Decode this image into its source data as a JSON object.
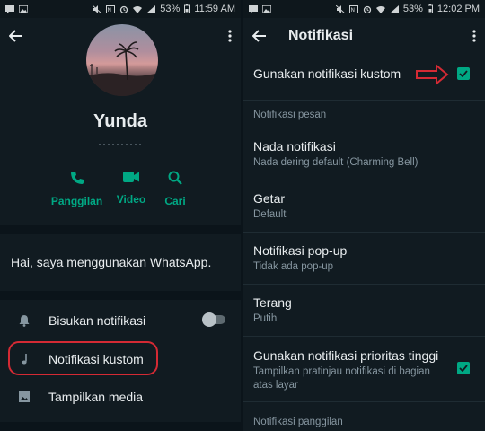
{
  "left": {
    "status": {
      "battery": "53%",
      "time": "11:59 AM"
    },
    "profile": {
      "name": "Yunda",
      "phone": "··········"
    },
    "actions": [
      {
        "icon": "phone-icon",
        "label": "Panggilan"
      },
      {
        "icon": "video-icon",
        "label": "Video"
      },
      {
        "icon": "search-icon",
        "label": "Cari"
      }
    ],
    "about": "Hai, saya menggunakan WhatsApp.",
    "settings": [
      {
        "icon": "bell-icon",
        "label": "Bisukan notifikasi"
      },
      {
        "icon": "music-note-icon",
        "label": "Notifikasi kustom"
      },
      {
        "icon": "image-icon",
        "label": "Tampilkan media"
      }
    ]
  },
  "right": {
    "status": {
      "battery": "53%",
      "time": "12:02 PM"
    },
    "title": "Notifikasi",
    "custom": {
      "label": "Gunakan notifikasi kustom"
    },
    "section_messages": "Notifikasi pesan",
    "items": [
      {
        "title": "Nada notifikasi",
        "subtitle": "Nada dering default (Charming Bell)"
      },
      {
        "title": "Getar",
        "subtitle": "Default"
      },
      {
        "title": "Notifikasi pop-up",
        "subtitle": "Tidak ada pop-up"
      },
      {
        "title": "Terang",
        "subtitle": "Putih"
      }
    ],
    "priority": {
      "title": "Gunakan notifikasi prioritas tinggi",
      "subtitle_line1": "Tampilkan pratinjau notifikasi di bagian",
      "subtitle_line2": "atas layar"
    },
    "section_calls": "Notifikasi panggilan"
  },
  "colors": {
    "accent": "#00a884",
    "background": "#111b21",
    "highlight": "#d42a34"
  }
}
